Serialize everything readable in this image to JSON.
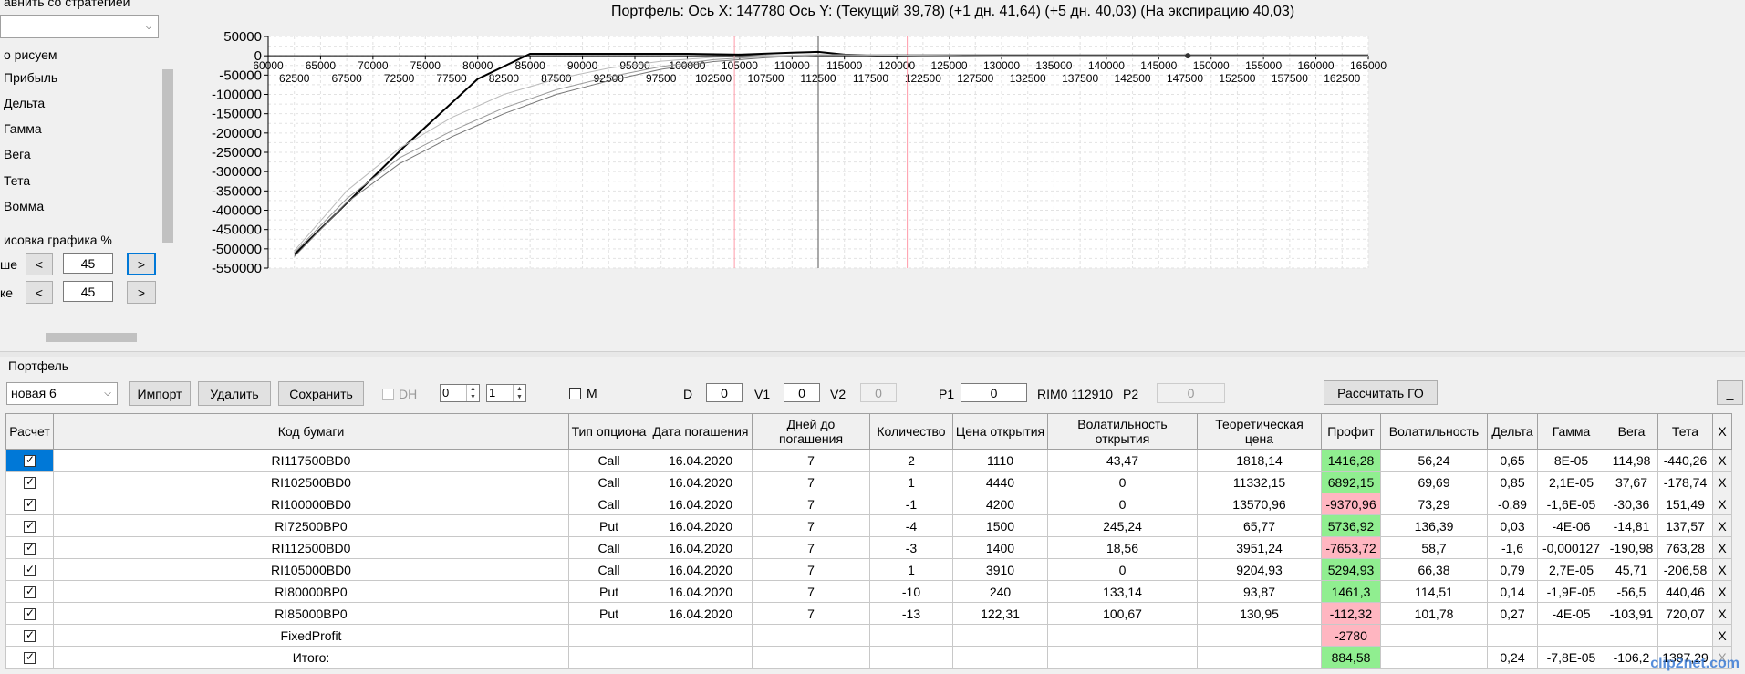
{
  "left_panel": {
    "compare_label": "авнить со стратегией",
    "draw_label": "о рисуем",
    "options": [
      "Прибыль",
      "Дельта",
      "Гамма",
      "Вега",
      "Тета",
      "Вомма"
    ],
    "render_label": "исовка графика %",
    "row1_label": "ше",
    "row1_value": "45",
    "row2_label": "ке",
    "row2_value": "45",
    "less": "<",
    "more": ">",
    "scroll_down": "˅"
  },
  "chart": {
    "title": "Портфель: Ось X: 147780 Ось Y:  (Текущий 39,78)  (+1 дн. 41,64)  (+5 дн. 40,03)  (На экспирацию 40,03)"
  },
  "chart_data": {
    "type": "line",
    "title": "Портфель: Ось X: 147780 Ось Y:  (Текущий 39,78)  (+1 дн. 41,64)  (+5 дн. 40,03)  (На экспирацию 40,03)",
    "xlim": [
      60000,
      165000
    ],
    "ylim": [
      -550000,
      50000
    ],
    "x_ticks_major": [
      60000,
      65000,
      70000,
      75000,
      80000,
      85000,
      90000,
      95000,
      100000,
      105000,
      110000,
      115000,
      120000,
      125000,
      130000,
      135000,
      140000,
      145000,
      150000,
      155000,
      160000,
      165000
    ],
    "x_ticks_minor": [
      62500,
      67500,
      72500,
      77500,
      82500,
      87500,
      92500,
      97500,
      102500,
      107500,
      112500,
      117500,
      122500,
      127500,
      132500,
      137500,
      142500,
      147500,
      152500,
      157500,
      162500
    ],
    "y_ticks": [
      50000,
      0,
      -50000,
      -100000,
      -150000,
      -200000,
      -250000,
      -300000,
      -350000,
      -400000,
      -450000,
      -500000,
      -550000
    ],
    "grid": true,
    "vertical_markers": [
      {
        "x": 104500,
        "color": "#ff9aa8"
      },
      {
        "x": 112500,
        "color": "#555555"
      },
      {
        "x": 121000,
        "color": "#ff9aa8"
      }
    ],
    "point_marker": {
      "x": 147780,
      "y": 0
    },
    "series": [
      {
        "color": "#000000",
        "width": 2,
        "x": [
          62500,
          73000,
          80000,
          85000,
          90000,
          100000,
          105000,
          110000,
          112500,
          115000,
          118000,
          122500,
          130000,
          150000,
          165000
        ],
        "y": [
          -515000,
          -235000,
          -60000,
          5000,
          5000,
          5000,
          3000,
          8000,
          10000,
          3000,
          1000,
          1000,
          1000,
          1000,
          1000
        ]
      },
      {
        "color": "#777777",
        "width": 1,
        "x": [
          62500,
          67500,
          72500,
          77500,
          82500,
          87500,
          92500,
          97500,
          102500,
          107500,
          112500,
          117500,
          122500,
          130000,
          150000,
          165000
        ],
        "y": [
          -520000,
          -380000,
          -280000,
          -210000,
          -150000,
          -100000,
          -65000,
          -35000,
          -15000,
          -5000,
          2000,
          2000,
          1000,
          0,
          0,
          0
        ]
      },
      {
        "color": "#999999",
        "width": 1,
        "x": [
          62500,
          67500,
          72500,
          77500,
          82500,
          87500,
          92500,
          97500,
          102500,
          107500,
          112500,
          117500,
          122500,
          130000,
          150000,
          165000
        ],
        "y": [
          -510000,
          -370000,
          -265000,
          -195000,
          -135000,
          -88000,
          -55000,
          -28000,
          -10000,
          -2000,
          3000,
          2000,
          1000,
          0,
          0,
          0
        ]
      },
      {
        "color": "#bbbbbb",
        "width": 1,
        "x": [
          62500,
          67500,
          72500,
          77500,
          82500,
          87500,
          92500,
          97500,
          102500,
          107500,
          112500,
          117500,
          122500,
          130000,
          150000,
          165000
        ],
        "y": [
          -505000,
          -350000,
          -240000,
          -160000,
          -100000,
          -60000,
          -32000,
          -14000,
          -4000,
          0,
          3000,
          2000,
          1000,
          0,
          0,
          0
        ]
      }
    ]
  },
  "portfolio": {
    "label": "Портфель",
    "name_value": "новая 6",
    "import_label": "Импорт",
    "delete_label": "Удалить",
    "save_label": "Сохранить",
    "dh_label": "DH",
    "spin1_value": "0",
    "spin2_value": "1",
    "m_label": "M",
    "d_label": "D",
    "d_value": "0",
    "v1_label": "V1",
    "v1_value": "0",
    "v2_label": "V2",
    "v2_value": "0",
    "p1_label": "P1",
    "p1_value": "0",
    "rim_label": "RIM0 112910",
    "p2_label": "P2",
    "p2_value": "0",
    "calc_go_label": "Рассчитать ГО",
    "minimize_label": "_"
  },
  "table": {
    "headers": [
      "Расчет",
      "Код бумаги",
      "Тип опциона",
      "Дата погашения",
      "Дней до погашения",
      "Количество",
      "Цена открытия",
      "Волатильность открытия",
      "Теоретическая цена",
      "Профит",
      "Волатильность",
      "Дельта",
      "Гамма",
      "Вега",
      "Тета",
      "X"
    ],
    "rows": [
      {
        "code": "RI117500BD0",
        "type": "Call",
        "date": "16.04.2020",
        "days": "7",
        "qty": "2",
        "open": "1110",
        "vol_open": "43,47",
        "theo": "1818,14",
        "profit": "1416,28",
        "profit_sign": "pos",
        "vol": "56,24",
        "delta": "0,65",
        "gamma": "8E-05",
        "vega": "114,98",
        "theta": "-440,26",
        "x": "X"
      },
      {
        "code": "RI102500BD0",
        "type": "Call",
        "date": "16.04.2020",
        "days": "7",
        "qty": "1",
        "open": "4440",
        "vol_open": "0",
        "theo": "11332,15",
        "profit": "6892,15",
        "profit_sign": "pos",
        "vol": "69,69",
        "delta": "0,85",
        "gamma": "2,1E-05",
        "vega": "37,67",
        "theta": "-178,74",
        "x": "X"
      },
      {
        "code": "RI100000BD0",
        "type": "Call",
        "date": "16.04.2020",
        "days": "7",
        "qty": "-1",
        "open": "4200",
        "vol_open": "0",
        "theo": "13570,96",
        "profit": "-9370,96",
        "profit_sign": "neg",
        "vol": "73,29",
        "delta": "-0,89",
        "gamma": "-1,6E-05",
        "vega": "-30,36",
        "theta": "151,49",
        "x": "X"
      },
      {
        "code": "RI72500BP0",
        "type": "Put",
        "date": "16.04.2020",
        "days": "7",
        "qty": "-4",
        "open": "1500",
        "vol_open": "245,24",
        "theo": "65,77",
        "profit": "5736,92",
        "profit_sign": "pos",
        "vol": "136,39",
        "delta": "0,03",
        "gamma": "-4E-06",
        "vega": "-14,81",
        "theta": "137,57",
        "x": "X"
      },
      {
        "code": "RI112500BD0",
        "type": "Call",
        "date": "16.04.2020",
        "days": "7",
        "qty": "-3",
        "open": "1400",
        "vol_open": "18,56",
        "theo": "3951,24",
        "profit": "-7653,72",
        "profit_sign": "neg",
        "vol": "58,7",
        "delta": "-1,6",
        "gamma": "-0,000127",
        "vega": "-190,98",
        "theta": "763,28",
        "x": "X"
      },
      {
        "code": "RI105000BD0",
        "type": "Call",
        "date": "16.04.2020",
        "days": "7",
        "qty": "1",
        "open": "3910",
        "vol_open": "0",
        "theo": "9204,93",
        "profit": "5294,93",
        "profit_sign": "pos",
        "vol": "66,38",
        "delta": "0,79",
        "gamma": "2,7E-05",
        "vega": "45,71",
        "theta": "-206,58",
        "x": "X"
      },
      {
        "code": "RI80000BP0",
        "type": "Put",
        "date": "16.04.2020",
        "days": "7",
        "qty": "-10",
        "open": "240",
        "vol_open": "133,14",
        "theo": "93,87",
        "profit": "1461,3",
        "profit_sign": "pos",
        "vol": "114,51",
        "delta": "0,14",
        "gamma": "-1,9E-05",
        "vega": "-56,5",
        "theta": "440,46",
        "x": "X"
      },
      {
        "code": "RI85000BP0",
        "type": "Put",
        "date": "16.04.2020",
        "days": "7",
        "qty": "-13",
        "open": "122,31",
        "vol_open": "100,67",
        "theo": "130,95",
        "profit": "-112,32",
        "profit_sign": "neg",
        "vol": "101,78",
        "delta": "0,27",
        "gamma": "-4E-05",
        "vega": "-103,91",
        "theta": "720,07",
        "x": "X"
      },
      {
        "code": "FixedProfit",
        "type": "",
        "date": "",
        "days": "",
        "qty": "",
        "open": "",
        "vol_open": "",
        "theo": "",
        "profit": "-2780",
        "profit_sign": "neg",
        "vol": "",
        "delta": "",
        "gamma": "",
        "vega": "",
        "theta": "",
        "x": "X"
      },
      {
        "code": "Итого:",
        "type": "",
        "date": "",
        "days": "",
        "qty": "",
        "open": "",
        "vol_open": "",
        "theo": "",
        "profit": "884,58",
        "profit_sign": "pos",
        "vol": "",
        "delta": "0,24",
        "gamma": "-7,8E-05",
        "vega": "-106,2",
        "theta": "1387,29",
        "x": "X"
      }
    ]
  },
  "watermark": "clip2net.com"
}
